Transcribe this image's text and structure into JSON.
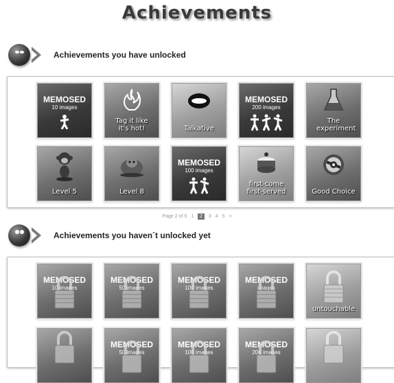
{
  "page_title": "Achievements",
  "unlocked_heading": "Achievements you have unlocked",
  "locked_heading": "Achievements you haven´t unlocked yet",
  "unlocked": [
    {
      "head": "MEMOSED",
      "sub": "10 images",
      "icon": "jumper-icon"
    },
    {
      "label": "Tag it like it's hot!",
      "icon": "flame-icon"
    },
    {
      "label": "Talkative",
      "icon": "lips-icon"
    },
    {
      "head": "MEMOSED",
      "sub": "200 images",
      "icon": "jumpers-icon"
    },
    {
      "label": "The experiment",
      "icon": "flask-icon"
    },
    {
      "label": "Level 5",
      "icon": "monkey-icon"
    },
    {
      "label": "Level 8",
      "icon": "creature-icon"
    },
    {
      "head": "MEMOSED",
      "sub": "100 images",
      "icon": "jumpers-icon"
    },
    {
      "label": "first-come first-served",
      "icon": "cake-icon"
    },
    {
      "label": "Good Choice",
      "icon": "orb-icon"
    }
  ],
  "pager": {
    "text": "Page 2 of 5",
    "pages": [
      "1",
      "2",
      "3",
      "4",
      "5"
    ],
    "current": "2",
    "next": ">"
  },
  "locked": [
    {
      "head": "MEMOSED",
      "sub": "10 images"
    },
    {
      "head": "MEMOSED",
      "sub": "50 images"
    },
    {
      "head": "MEMOSED",
      "sub": "100 images"
    },
    {
      "head": "MEMOSED",
      "sub": "images"
    },
    {
      "label": "untouchable"
    },
    {},
    {
      "head": "MEMOSED",
      "sub": "50 images"
    },
    {
      "head": "MEMOSED",
      "sub": "100 images"
    },
    {
      "head": "MEMOSED",
      "sub": "200 images"
    },
    {}
  ]
}
